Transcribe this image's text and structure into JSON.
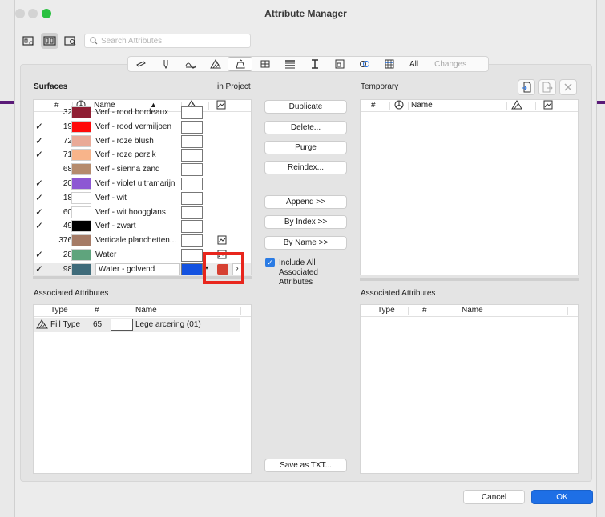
{
  "window": {
    "title": "Attribute Manager"
  },
  "search": {
    "placeholder": "Search Attributes"
  },
  "toolbar": {
    "types": [
      "surface-type-icon",
      "pen-icon",
      "line-type-icon",
      "fill-type-icon",
      "surfaces-icon",
      "building-material-icon",
      "composite-icon",
      "profile-icon",
      "zone-category-icon",
      "mep-icon",
      "markup-icon"
    ],
    "all_label": "All",
    "changes_label": "Changes"
  },
  "project": {
    "section_label": "Surfaces",
    "location_label": "in Project",
    "columns": {
      "index": "#",
      "name": "Name"
    },
    "rows": [
      {
        "checked": false,
        "index": "32",
        "color": "#8f1e33",
        "name": "Verf - rood bordeaux",
        "has_texture": false
      },
      {
        "checked": true,
        "index": "19",
        "color": "#ff0a0a",
        "name": "Verf - rood vermiljoen",
        "has_texture": false
      },
      {
        "checked": true,
        "index": "72",
        "color": "#e9aa98",
        "name": "Verf - roze blush",
        "has_texture": false
      },
      {
        "checked": true,
        "index": "71",
        "color": "#f8b48a",
        "name": "Verf - roze perzik",
        "has_texture": false
      },
      {
        "checked": false,
        "index": "68",
        "color": "#b58b6d",
        "name": "Verf - sienna zand",
        "has_texture": false
      },
      {
        "checked": true,
        "index": "20",
        "color": "#8d57d3",
        "name": "Verf - violet ultramarijn",
        "has_texture": false
      },
      {
        "checked": true,
        "index": "18",
        "color": "#ffffff",
        "name": "Verf - wit",
        "has_texture": false
      },
      {
        "checked": true,
        "index": "60",
        "color": "#ffffff",
        "name": "Verf - wit hoogglans",
        "has_texture": false
      },
      {
        "checked": true,
        "index": "49",
        "color": "#000000",
        "name": "Verf - zwart",
        "has_texture": false
      },
      {
        "checked": false,
        "index": "376",
        "color": "#a57b66",
        "name": "Verticale planchetten...",
        "has_texture": true
      },
      {
        "checked": true,
        "index": "28",
        "color": "#5fa47d",
        "name": "Water",
        "has_texture": true
      },
      {
        "checked": true,
        "index": "98",
        "color": "#3f6b7a",
        "name": "Water - golvend",
        "has_texture": true,
        "selected": true,
        "fill_color": "#1452e0"
      }
    ]
  },
  "associated_left": {
    "label": "Associated Attributes",
    "columns": {
      "type": "Type",
      "index": "#",
      "name": "Name"
    },
    "rows": [
      {
        "type": "Fill Type",
        "index": "65",
        "name": "Lege arcering (01)"
      }
    ]
  },
  "actions": {
    "duplicate": "Duplicate",
    "delete": "Delete...",
    "purge": "Purge",
    "reindex": "Reindex...",
    "append": "Append >>",
    "by_index": "By Index >>",
    "by_name": "By Name >>",
    "include_all_line1": "Include All",
    "include_all_line2": "Associated",
    "include_all_line3": "Attributes",
    "save_txt": "Save as TXT..."
  },
  "temporary": {
    "label": "Temporary",
    "columns": {
      "index": "#",
      "name": "Name"
    }
  },
  "associated_right": {
    "label": "Associated Attributes",
    "columns": {
      "type": "Type",
      "index": "#",
      "name": "Name"
    }
  },
  "footer": {
    "cancel": "Cancel",
    "ok": "OK"
  },
  "colors": {
    "accent": "#1e6fe6",
    "highlight": "#e8261d"
  }
}
